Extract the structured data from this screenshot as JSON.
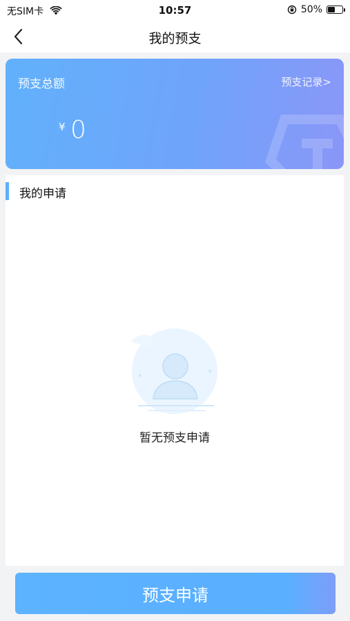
{
  "status_bar": {
    "carrier": "无SIM卡",
    "time": "10:57",
    "battery": "50%",
    "battery_level": 0.5,
    "icons": [
      "wifi-icon",
      "orientation-lock-icon",
      "battery-icon"
    ]
  },
  "nav": {
    "title": "我的预支",
    "back_icon": "chevron-left-icon"
  },
  "summary_card": {
    "label": "预支总额",
    "records_link": "预支记录>",
    "currency": "¥",
    "amount": "0",
    "colors": {
      "start": "#61b1fb",
      "end": "#8a96f7"
    }
  },
  "applications": {
    "heading": "我的申请",
    "empty_text": "暂无预支申请",
    "empty_icon": "empty-user-icon"
  },
  "footer": {
    "apply_button": "预支申请"
  },
  "colors": {
    "accent": "#5cb1ff",
    "page_background": "#f2f3f5"
  }
}
